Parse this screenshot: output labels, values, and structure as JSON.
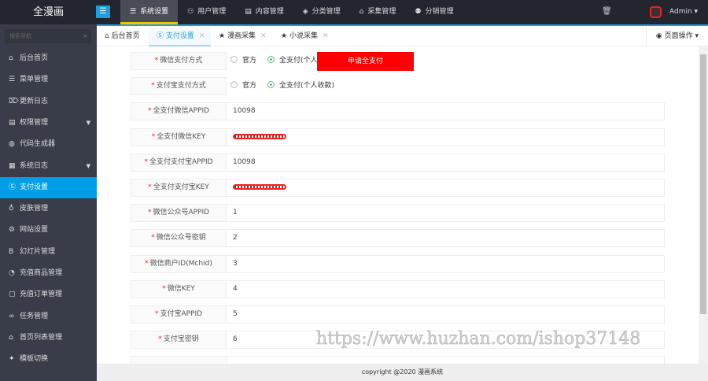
{
  "app": {
    "title": "全漫画",
    "admin": "Admin"
  },
  "nav": [
    {
      "label": "系统设置",
      "icon": "menu-icon"
    },
    {
      "label": "用户管理",
      "icon": "user-icon"
    },
    {
      "label": "内容管理",
      "icon": "doc-icon"
    },
    {
      "label": "分类管理",
      "icon": "layers-icon"
    },
    {
      "label": "采集管理",
      "icon": "home-icon"
    },
    {
      "label": "分销管理",
      "icon": "users-icon"
    }
  ],
  "sidebar": {
    "search_placeholder": "搜索导航",
    "items": [
      {
        "label": "后台首页",
        "icon": "⌂"
      },
      {
        "label": "菜单管理",
        "icon": "☰"
      },
      {
        "label": "更新日志",
        "icon": "⌦"
      },
      {
        "label": "权限管理",
        "icon": "▤",
        "arrow": true
      },
      {
        "label": "代码生成器",
        "icon": "◍"
      },
      {
        "label": "系统日志",
        "icon": "▦",
        "arrow": true
      },
      {
        "label": "支付设置",
        "icon": "Ⓢ",
        "active": true
      },
      {
        "label": "皮肤管理",
        "icon": "♁"
      },
      {
        "label": "网站设置",
        "icon": "⚙"
      },
      {
        "label": "幻灯片管理",
        "icon": "B"
      },
      {
        "label": "充值商品管理",
        "icon": "◔"
      },
      {
        "label": "充值订单管理",
        "icon": "▢"
      },
      {
        "label": "任务管理",
        "icon": "∞"
      },
      {
        "label": "首页列表管理",
        "icon": "⌂"
      },
      {
        "label": "模板切换",
        "icon": "✦"
      }
    ]
  },
  "tabs": [
    {
      "label": "后台首页",
      "icon": "⌂"
    },
    {
      "label": "支付设置",
      "icon": "Ⓢ",
      "active": true
    },
    {
      "label": "漫画采集",
      "icon": "★"
    },
    {
      "label": "小说采集",
      "icon": "★"
    }
  ],
  "page_op": "页面操作",
  "form": {
    "radio_options": [
      "官方",
      "全支付(个人收款)"
    ],
    "apply_button": "申请全支付",
    "rows": [
      {
        "label": "微信支付方式",
        "type": "radio",
        "selected": 1
      },
      {
        "label": "支付宝支付方式",
        "type": "radio",
        "selected": 1
      },
      {
        "label": "全支付微信APPID",
        "value": "10098"
      },
      {
        "label": "全支付微信KEY",
        "redacted": true
      },
      {
        "label": "全支付支付宝APPID",
        "value": "10098"
      },
      {
        "label": "全支付支付宝KEY",
        "redacted": true
      },
      {
        "label": "微信公众号APPID",
        "value": "1"
      },
      {
        "label": "微信公众号密钥",
        "value": "2"
      },
      {
        "label": "微信商户ID(Mchid)",
        "value": "3"
      },
      {
        "label": "微信KEY",
        "value": "4"
      },
      {
        "label": "支付宝APPID",
        "value": "5"
      },
      {
        "label": "支付宝密钥",
        "value": "6"
      },
      {
        "label": "",
        "value": ""
      }
    ]
  },
  "footer": "copyright @2020 漫画系统",
  "watermark": "https://www.huzhan.com/ishop37148"
}
